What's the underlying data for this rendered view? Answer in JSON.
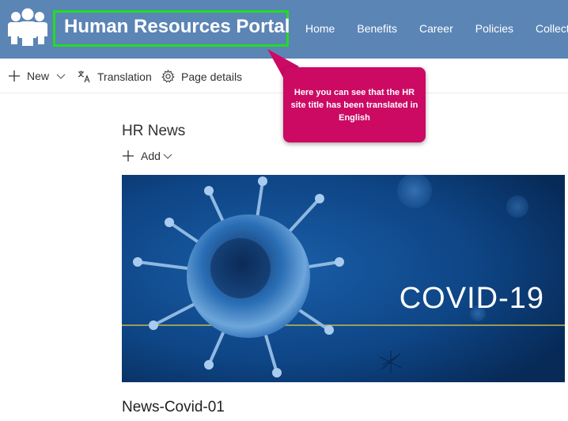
{
  "header": {
    "site_title": "Human Resources Portal",
    "nav": [
      "Home",
      "Benefits",
      "Career",
      "Policies",
      "Collective"
    ],
    "background_color": "#5b85b5",
    "logo_icon": "people-group-icon"
  },
  "commandbar": {
    "new_label": "New",
    "translation_label": "Translation",
    "page_details_label": "Page details"
  },
  "callout": {
    "text": "Here you can see that the HR site title has been translated in English",
    "color": "#cc0a64"
  },
  "section": {
    "title": "HR News",
    "add_label": "Add"
  },
  "news": {
    "image_text": "COVID-19",
    "title": "News-Covid-01"
  }
}
